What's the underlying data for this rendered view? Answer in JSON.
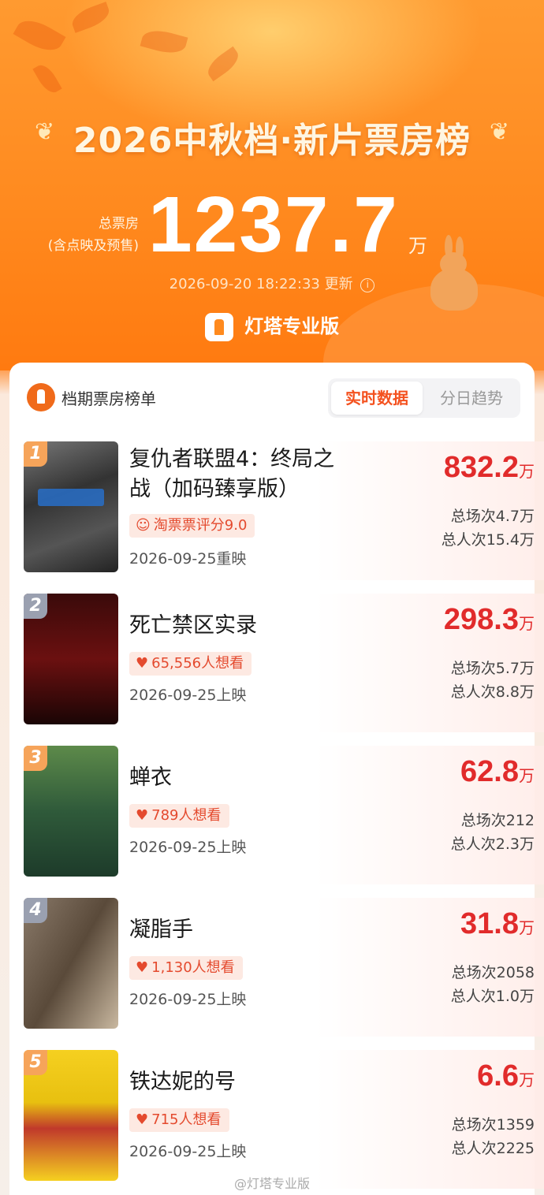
{
  "header": {
    "title": "2026中秋档·新片票房榜",
    "total_label_line1": "总票房",
    "total_label_line2": "(含点映及预售)",
    "total_value": "1237.7",
    "total_unit": "万",
    "update_time": "2026-09-20 18:22:33 更新",
    "brand": "灯塔专业版"
  },
  "card": {
    "title": "档期票房榜单",
    "tabs": [
      {
        "label": "实时数据",
        "active": true
      },
      {
        "label": "分日趋势",
        "active": false
      }
    ]
  },
  "movies": [
    {
      "rank": "1",
      "name": "复仇者联盟4：终局之战（加码臻享版）",
      "tag": "淘票票评分9.0",
      "tag_icon": "rating-icon",
      "release": "2026-09-25重映",
      "box_office": "832.2",
      "unit": "万",
      "shows": "总场次4.7万",
      "viewers": "总人次15.4万"
    },
    {
      "rank": "2",
      "name": "死亡禁区实录",
      "tag": "65,556人想看",
      "tag_icon": "heart-icon",
      "release": "2026-09-25上映",
      "box_office": "298.3",
      "unit": "万",
      "shows": "总场次5.7万",
      "viewers": "总人次8.8万"
    },
    {
      "rank": "3",
      "name": "蝉衣",
      "tag": "789人想看",
      "tag_icon": "heart-icon",
      "release": "2026-09-25上映",
      "box_office": "62.8",
      "unit": "万",
      "shows": "总场次212",
      "viewers": "总人次2.3万"
    },
    {
      "rank": "4",
      "name": "凝脂手",
      "tag": "1,130人想看",
      "tag_icon": "heart-icon",
      "release": "2026-09-25上映",
      "box_office": "31.8",
      "unit": "万",
      "shows": "总场次2058",
      "viewers": "总人次1.0万"
    },
    {
      "rank": "5",
      "name": "铁达妮的号",
      "tag": "715人想看",
      "tag_icon": "heart-icon",
      "release": "2026-09-25上映",
      "box_office": "6.6",
      "unit": "万",
      "shows": "总场次1359",
      "viewers": "总人次2225"
    }
  ],
  "colors": {
    "accent": "#f4511e",
    "box_office": "#e12b2b",
    "tag_bg": "#fde9e2"
  },
  "footer": "@灯塔专业版"
}
